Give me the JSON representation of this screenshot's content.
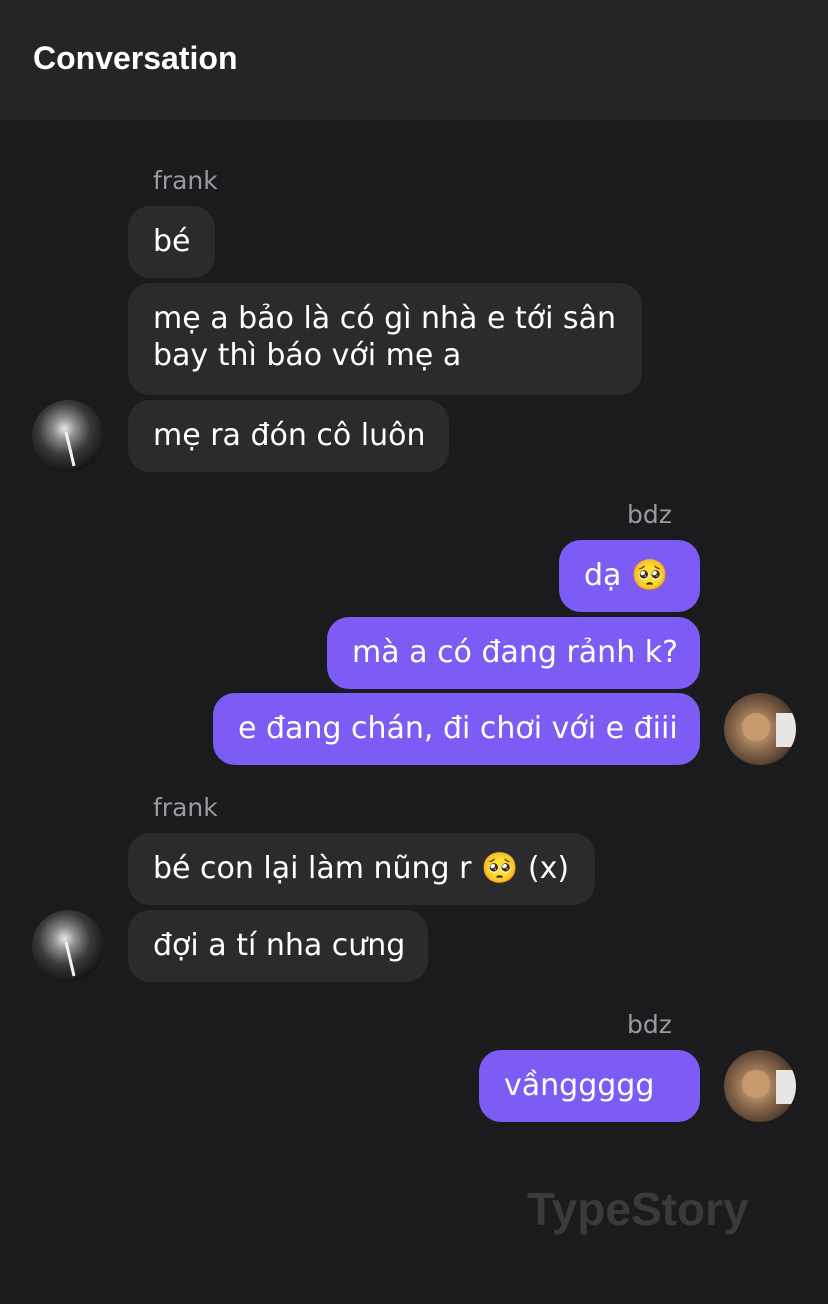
{
  "header": {
    "title": "Conversation"
  },
  "thread": {
    "group1": {
      "sender": "frank",
      "messages": [
        "bé",
        "mẹ a bảo là có gì nhà e tới sân bay thì báo với mẹ a",
        "mẹ ra đón cô luôn"
      ]
    },
    "group2": {
      "sender": "bdz",
      "messages": [
        "dạ 🥺",
        "mà a có đang rảnh k?",
        "e đang chán, đi chơi với e điii"
      ]
    },
    "group3": {
      "sender": "frank",
      "messages": [
        "bé con lại làm nũng r 🥺  (x)",
        "đợi a tí nha cưng"
      ]
    },
    "group4": {
      "sender": "bdz",
      "messages": [
        "vầnggggg"
      ]
    }
  },
  "watermark": "TypeStory",
  "colors": {
    "background": "#1b1b1d",
    "header": "#252527",
    "incoming_bubble": "#2b2b2e",
    "outgoing_bubble": "#7c5cf5"
  }
}
